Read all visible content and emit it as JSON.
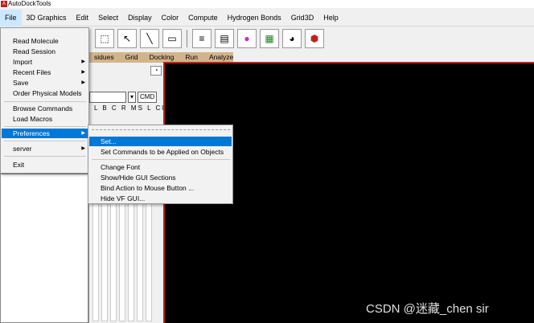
{
  "window": {
    "title": "AutoDockTools"
  },
  "menubar": {
    "items": [
      "File",
      "3D Graphics",
      "Edit",
      "Select",
      "Display",
      "Color",
      "Compute",
      "Hydrogen Bonds",
      "Grid3D",
      "Help"
    ]
  },
  "tabs": [
    "sidues",
    "Grid",
    "Docking",
    "Run",
    "Analyze"
  ],
  "mid": {
    "cmd_label": "CMD",
    "column_header": "L B C R MS L Cl"
  },
  "file_menu": {
    "items": [
      {
        "label": "Read Molecule",
        "has_submenu": false
      },
      {
        "label": "Read Session",
        "has_submenu": false
      },
      {
        "label": "Import",
        "has_submenu": true
      },
      {
        "label": "Recent Files",
        "has_submenu": true
      },
      {
        "label": "Save",
        "has_submenu": true
      },
      {
        "label": "Order Physical Models",
        "has_submenu": false
      },
      {
        "label": "Browse Commands",
        "has_submenu": false
      },
      {
        "label": "Load Macros",
        "has_submenu": false
      },
      {
        "label": "Preferences",
        "has_submenu": true,
        "highlighted": true
      },
      {
        "label": "server",
        "has_submenu": true
      },
      {
        "label": "Exit",
        "has_submenu": false
      }
    ]
  },
  "preferences_submenu": {
    "items": [
      {
        "label": "Set...",
        "highlighted": true
      },
      {
        "label": "Set Commands to be Applied on Objects"
      },
      {
        "label": "Change Font"
      },
      {
        "label": "Show/Hide GUI Sections"
      },
      {
        "label": "Bind Action to Mouse Button ..."
      },
      {
        "label": "Hide VF GUI..."
      }
    ]
  },
  "watermark": "CSDN @迷藏_chen sir",
  "colors": {
    "highlight": "#0078d7",
    "viewer_bg": "#000000",
    "tab_bg": "#d2b48c",
    "viewer_border": "#c02020"
  }
}
